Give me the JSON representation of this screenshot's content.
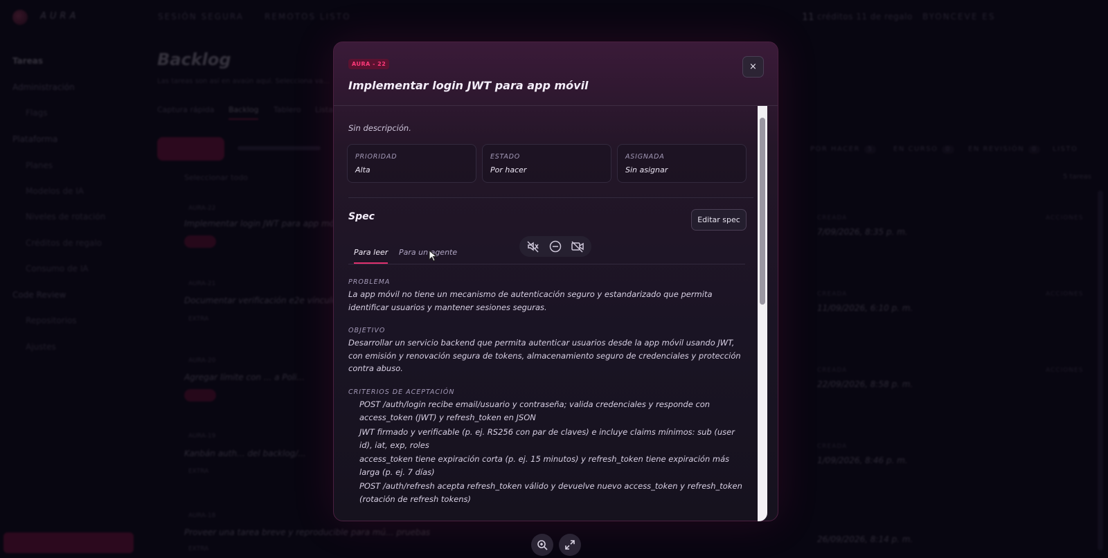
{
  "app": {
    "brand": "AURA",
    "topbar": {
      "session": "SESIÓN SEGURA",
      "status": "REMOTOS LISTO",
      "credits_count": "11",
      "credits_label": "créditos 11 de regalo",
      "user": "BYONCEVE ES"
    }
  },
  "sidebar": {
    "items": [
      {
        "label": "Tareas"
      },
      {
        "label": "Administración"
      },
      {
        "label": "Flags"
      },
      {
        "label": "Plataforma"
      },
      {
        "label": "Planes"
      },
      {
        "label": "Modelos de IA"
      },
      {
        "label": "Niveles de rotación"
      },
      {
        "label": "Créditos de regalo"
      },
      {
        "label": "Consumo de IA"
      },
      {
        "label": "Code Review"
      },
      {
        "label": "Repositorios"
      },
      {
        "label": "Ajustes"
      }
    ]
  },
  "main": {
    "title": "Backlog",
    "subtitle": "Las tareas son así en avaún aquí. Selecciona va...",
    "tabs": [
      "Captura rápida",
      "Backlog",
      "Tablero",
      "Lista"
    ],
    "select_all": "Seleccionar todo",
    "backlog_items": [
      {
        "id": "AURA-22",
        "title": "Implementar login JWT para app móvil"
      },
      {
        "id": "AURA-21",
        "title": "Documentar verificación e2e vínculo d...",
        "tag": "EXTRA"
      },
      {
        "id": "AURA-20",
        "title": "Agregar límite con ... a Poli..."
      },
      {
        "id": "AURA-19",
        "title": "Kanbán auth... del backlog/...",
        "tag": "EXTRA"
      },
      {
        "id": "AURA-18",
        "title": "Proveer una tarea breve y reproducible para mú... pruebas",
        "tag": "EXTRA"
      }
    ],
    "columns": [
      {
        "label": "POR HACER",
        "count": "5"
      },
      {
        "label": "EN CURSO",
        "count": "0"
      },
      {
        "label": "EN REVISIÓN",
        "count": "0"
      },
      {
        "label": "LISTO",
        "count": "0"
      }
    ],
    "count_label": "5 tareas",
    "right_rows": [
      {
        "label": "CREADA",
        "date": "7/09/2026, 8:35 p. m.",
        "tag": "ACCIONES"
      },
      {
        "label": "CREADA",
        "date": "11/09/2026, 6:10 p. m.",
        "tag": "ACCIONES"
      },
      {
        "label": "CREADA",
        "date": "22/09/2026, 8:58 p. m.",
        "tag": "ACCIONES"
      },
      {
        "label": "CREADA",
        "date": "1/09/2026, 8:46 p. m.",
        "tag": ""
      },
      {
        "label": "",
        "date": "26/09/2026, 8:14 p. m.",
        "tag": ""
      }
    ]
  },
  "modal": {
    "task_id": "AURA - 22",
    "title": "Implementar login JWT para app móvil",
    "close": "×",
    "description": "Sin descripción.",
    "fields": [
      {
        "label": "PRIORIDAD",
        "value": "Alta"
      },
      {
        "label": "ESTADO",
        "value": "Por hacer"
      },
      {
        "label": "ASIGNADA",
        "value": "Sin asignar"
      }
    ],
    "spec_title": "Spec",
    "edit_spec": "Editar spec",
    "spec_tabs": [
      "Para leer",
      "Para un agente"
    ],
    "problema_label": "PROBLEMA",
    "problema_text": "La app móvil no tiene un mecanismo de autenticación seguro y estandarizado que permita identificar usuarios y mantener sesiones seguras.",
    "objetivo_label": "OBJETIVO",
    "objetivo_text": "Desarrollar un servicio backend que permita autenticar usuarios desde la app móvil usando JWT, con emisión y renovación segura de tokens, almacenamiento seguro de credenciales y protección contra abuso.",
    "criterios_label": "CRITERIOS DE ACEPTACIÓN",
    "criterios": [
      "POST /auth/login recibe email/usuario y contraseña; valida credenciales y responde con access_token (JWT) y refresh_token en JSON",
      "JWT firmado y verificable (p. ej. RS256 con par de claves) e incluye claims mínimos: sub (user id), iat, exp, roles",
      "access_token tiene expiración corta (p. ej. 15 minutos) y refresh_token tiene expiración más larga (p. ej. 7 días)",
      "POST /auth/refresh acepta refresh_token válido y devuelve nuevo access_token y refresh_token (rotación de refresh tokens)"
    ]
  },
  "colors": {
    "accent": "#e0306e",
    "badge_text": "#ff3a7a",
    "background": "#0a0814"
  },
  "icons": [
    "speaker-muted-icon",
    "minus-circle-icon",
    "camera-off-icon",
    "zoom-in-icon",
    "expand-icon",
    "close-icon"
  ]
}
